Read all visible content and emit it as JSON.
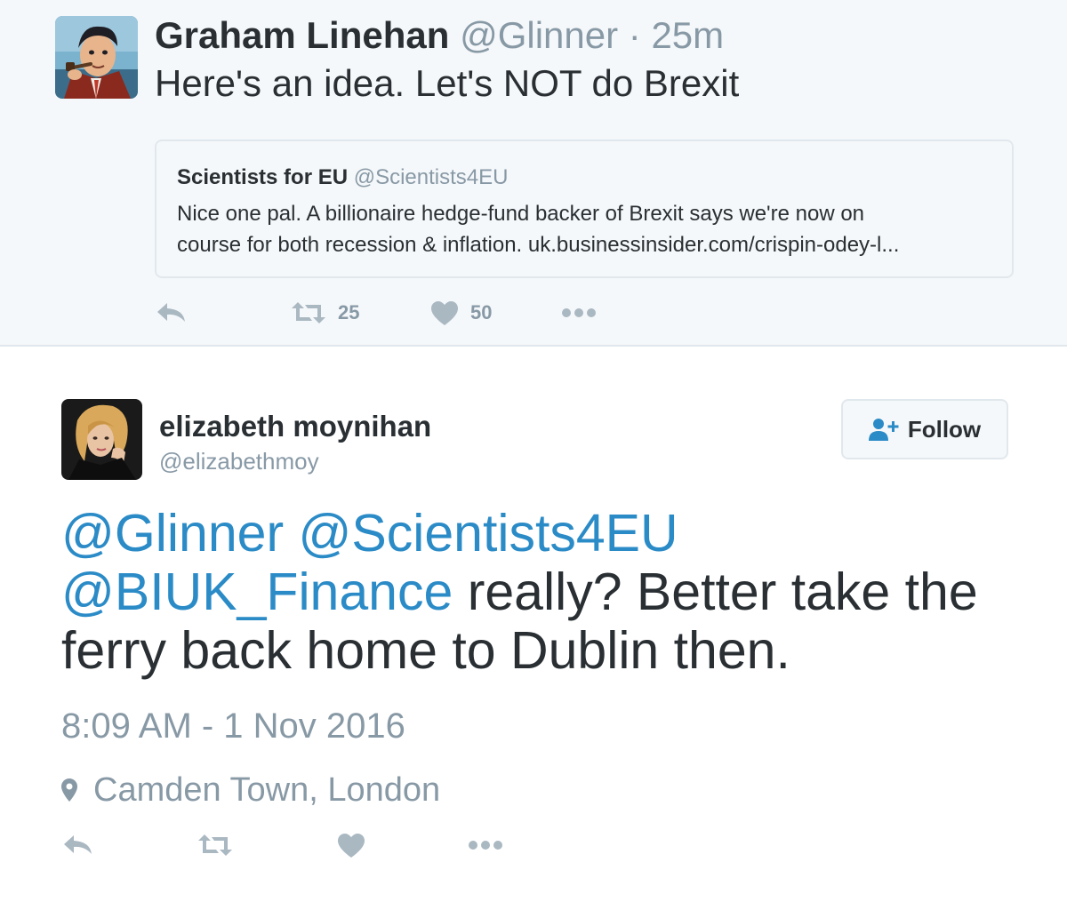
{
  "parent_tweet": {
    "author_name": "Graham Linehan",
    "author_handle": "@Glinner",
    "separator": "·",
    "time_ago": "25m",
    "text": "Here's an idea. Let's NOT do Brexit",
    "quoted_tweet": {
      "author_name": "Scientists for EU",
      "author_handle": "@Scientists4EU",
      "text_line1": "Nice one pal. A billionaire hedge-fund backer of Brexit says we're now on",
      "text_line2": "course for both recession & inflation. uk.businessinsider.com/crispin-odey-l..."
    },
    "actions": {
      "retweet_count": "25",
      "like_count": "50"
    }
  },
  "main_tweet": {
    "author_name": "elizabeth moynihan",
    "author_handle": "@elizabethmoy",
    "follow_label": "Follow",
    "text": {
      "mention1": "@Glinner",
      "mention2": "@Scientists4EU",
      "mention3": "@BIUK_Finance",
      "rest_line2": " really? Better take the",
      "line3": "ferry back home to Dublin then."
    },
    "timestamp": "8:09 AM - 1 Nov 2016",
    "location": "Camden Town, London"
  },
  "colors": {
    "link_blue": "#2b8bc7",
    "text_dark": "#292f33",
    "text_gray": "#8899a6",
    "icon_gray": "#aab8c2",
    "background_light": "#f5f8fa",
    "border": "#e1e8ed"
  },
  "icons": [
    "reply-icon",
    "retweet-icon",
    "like-icon",
    "more-icon",
    "follow-person-icon",
    "location-pin-icon"
  ]
}
